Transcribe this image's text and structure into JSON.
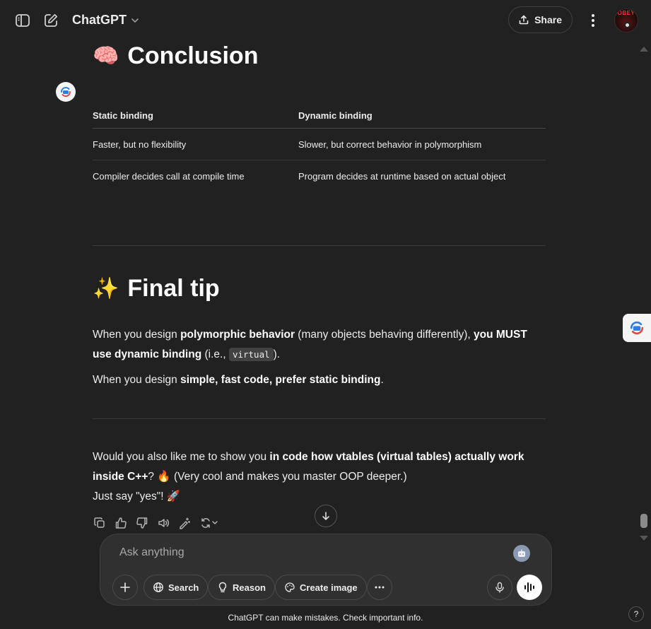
{
  "header": {
    "model_name": "ChatGPT",
    "share_label": "Share",
    "avatar_text": "OBEY"
  },
  "conclusion": {
    "emoji": "🧠",
    "title": "Conclusion",
    "table": {
      "headers": [
        "Static binding",
        "Dynamic binding"
      ],
      "rows": [
        [
          "Faster, but no flexibility",
          "Slower, but correct behavior in polymorphism"
        ],
        [
          "Compiler decides call at compile time",
          "Program decides at runtime based on actual object"
        ]
      ]
    }
  },
  "final_tip": {
    "emoji": "✨",
    "title": "Final tip",
    "p1_a": "When you design ",
    "p1_b": "polymorphic behavior",
    "p1_c": " (many objects behaving differently), ",
    "p1_d": "you MUST use dynamic binding",
    "p1_e": " (i.e., ",
    "p1_code": "virtual",
    "p1_f": ").",
    "p2_a": "When you design ",
    "p2_b": "simple, fast code, prefer static binding",
    "p2_c": "."
  },
  "followup": {
    "a": "Would you also like me to show you ",
    "b": "in code how vtables (virtual tables) actually work inside C++",
    "c": "? 🔥 (Very cool and makes you master OOP deeper.)",
    "d": "Just say \"yes\"! 🚀"
  },
  "composer": {
    "placeholder": "Ask anything",
    "search_label": "Search",
    "reason_label": "Reason",
    "create_image_label": "Create image"
  },
  "disclaimer": "ChatGPT can make mistakes. Check important info.",
  "help": "?"
}
